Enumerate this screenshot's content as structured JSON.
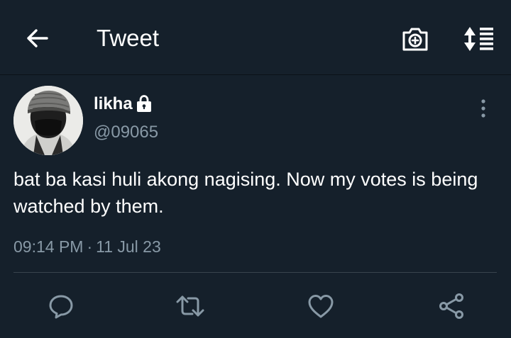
{
  "header": {
    "title": "Tweet",
    "back_icon": "arrow-left-icon",
    "camera_icon": "camera-plus-icon",
    "sort_icon": "sort-list-icon"
  },
  "tweet": {
    "author_name": "likha",
    "author_handle": "@09065",
    "protected_icon": "lock-icon",
    "more_icon": "more-vertical-icon",
    "text": "bat ba kasi huli akong nagising. Now my votes is being watched by them.",
    "time": "09:14 PM",
    "separator": "·",
    "date": "11 Jul 23"
  },
  "actions": {
    "reply_icon": "reply-icon",
    "retweet_icon": "retweet-icon",
    "like_icon": "heart-icon",
    "share_icon": "share-icon"
  },
  "colors": {
    "background": "#15202b",
    "text_primary": "#ffffff",
    "text_secondary": "#8899a6",
    "divider": "#38444d"
  }
}
